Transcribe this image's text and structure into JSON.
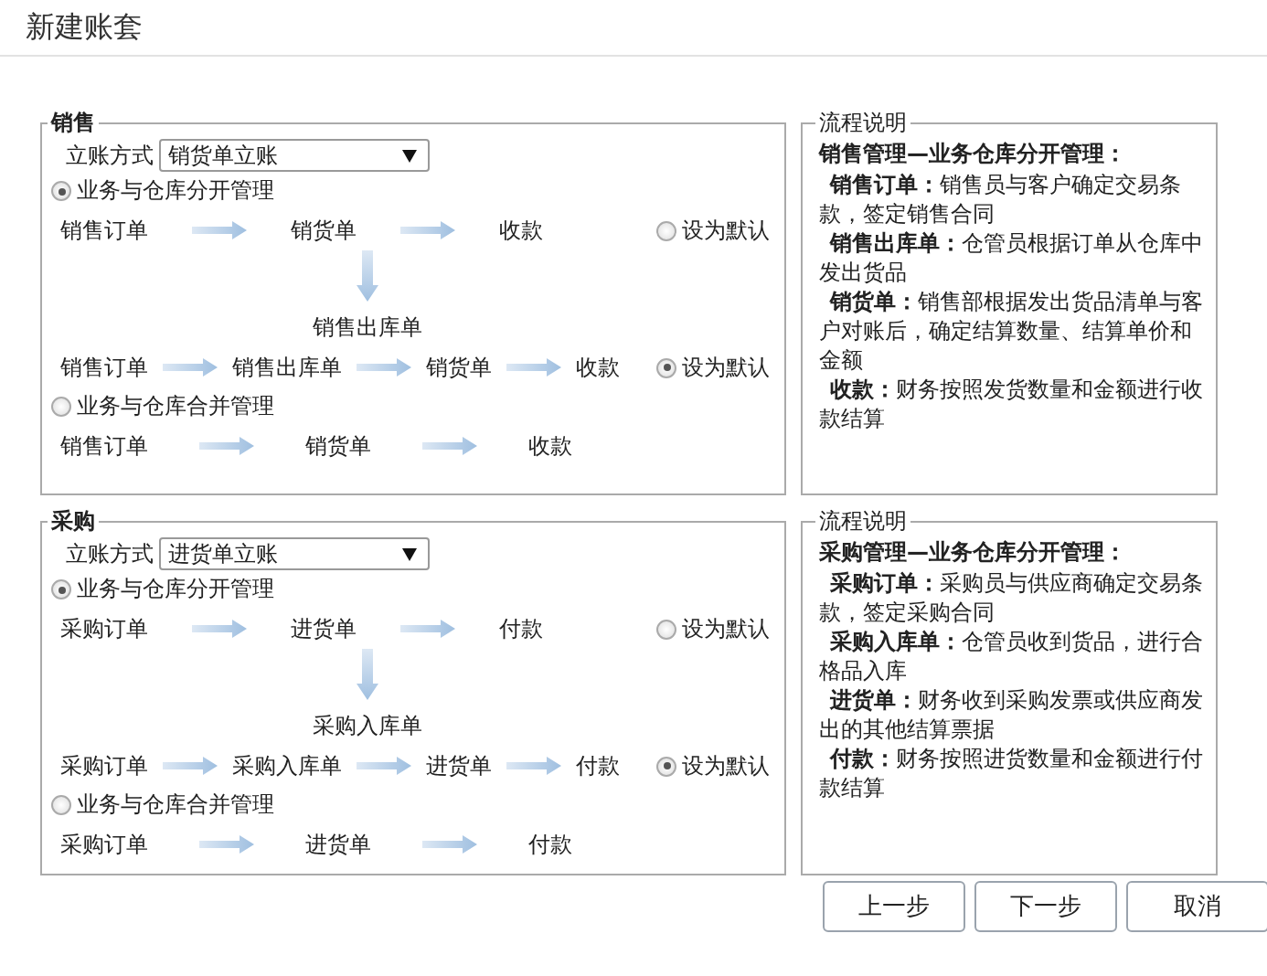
{
  "title": "新建账套",
  "sections": [
    {
      "legend": "销售",
      "method_label": "立账方式",
      "method_value": "销货单立账",
      "modes": [
        {
          "label": "业务与仓库分开管理",
          "selected": true,
          "flows": [
            {
              "steps": [
                "销售订单",
                "销货单",
                "收款"
              ],
              "default_label": "设为默认",
              "default_selected": false,
              "branch": "销售出库单"
            },
            {
              "steps": [
                "销售订单",
                "销售出库单",
                "销货单",
                "收款"
              ],
              "default_label": "设为默认",
              "default_selected": true
            }
          ]
        },
        {
          "label": "业务与仓库合并管理",
          "selected": false,
          "flows": [
            {
              "steps": [
                "销售订单",
                "销货单",
                "收款"
              ]
            }
          ]
        }
      ],
      "help": {
        "legend": "流程说明",
        "heading": "销售管理—业务仓库分开管理：",
        "items": [
          "**销售订单：**销售员与客户确定交易条款，签定销售合同",
          "**销售出库单：**仓管员根据订单从仓库中发出货品",
          "**销货单：**销售部根据发出货品清单与客户对账后，确定结算数量、结算单价和金额",
          "**收款：**财务按照发货数量和金额进行收款结算"
        ]
      }
    },
    {
      "legend": "采购",
      "method_label": "立账方式",
      "method_value": "进货单立账",
      "modes": [
        {
          "label": "业务与仓库分开管理",
          "selected": true,
          "flows": [
            {
              "steps": [
                "采购订单",
                "进货单",
                "付款"
              ],
              "default_label": "设为默认",
              "default_selected": false,
              "branch": "采购入库单"
            },
            {
              "steps": [
                "采购订单",
                "采购入库单",
                "进货单",
                "付款"
              ],
              "default_label": "设为默认",
              "default_selected": true
            }
          ]
        },
        {
          "label": "业务与仓库合并管理",
          "selected": false,
          "flows": [
            {
              "steps": [
                "采购订单",
                "进货单",
                "付款"
              ]
            }
          ]
        }
      ],
      "help": {
        "legend": "流程说明",
        "heading": "采购管理—业务仓库分开管理：",
        "items": [
          "**采购订单：**采购员与供应商确定交易条款，签定采购合同",
          "**采购入库单：**仓管员收到货品，进行合格品入库",
          "**进货单：**财务收到采购发票或供应商发出的其他结算票据",
          "**付款：**财务按照进货数量和金额进行付款结算"
        ]
      }
    }
  ],
  "buttons": [
    "上一步",
    "下一步",
    "取消"
  ]
}
